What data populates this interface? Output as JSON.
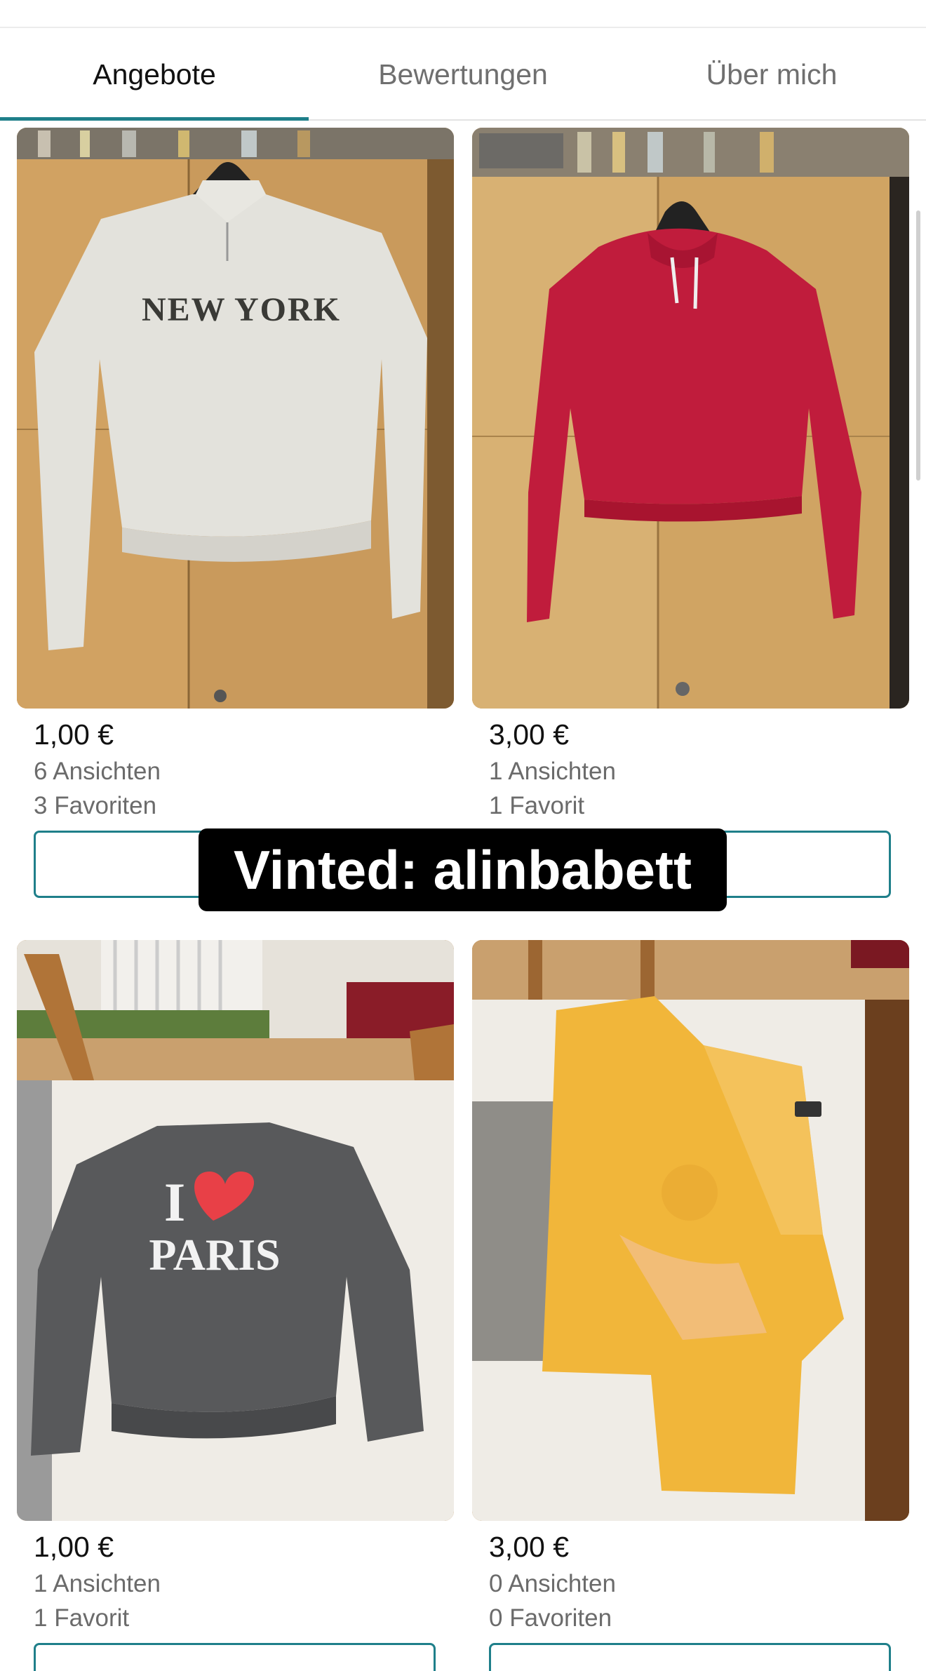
{
  "tabs": [
    {
      "label": "Angebote",
      "active": true
    },
    {
      "label": "Bewertungen",
      "active": false
    },
    {
      "label": "Über mich",
      "active": false
    }
  ],
  "items": [
    {
      "price": "1,00 €",
      "views": "6 Ansichten",
      "favorites": "3 Favoriten",
      "image": "cream-sherpa-new-york-pullover"
    },
    {
      "price": "3,00 €",
      "views": "1 Ansichten",
      "favorites": "1 Favorit",
      "image": "red-cropped-hoodie"
    },
    {
      "price": "1,00 €",
      "views": "1 Ansichten",
      "favorites": "1 Favorit",
      "image": "grey-i-love-paris-sweatshirt"
    },
    {
      "price": "3,00 €",
      "views": "0 Ansichten",
      "favorites": "0 Favoriten",
      "image": "yellow-tie-dye-shirt"
    }
  ],
  "overlay_text": "Vinted: alinbabett",
  "colors": {
    "accent": "#1f7f8a"
  }
}
